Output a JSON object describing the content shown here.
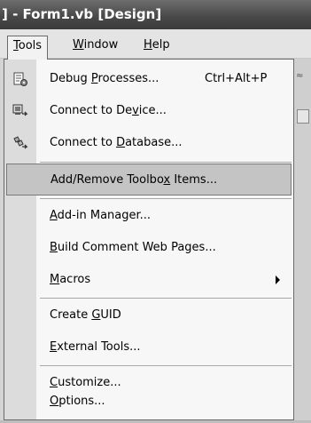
{
  "window": {
    "title": "] - Form1.vb [Design]"
  },
  "menubar": {
    "items": [
      {
        "label": "Tools",
        "mnemonic": "T",
        "rest": "ools",
        "active": true
      },
      {
        "label": "Window",
        "mnemonic": "W",
        "rest": "indow",
        "active": false
      },
      {
        "label": "Help",
        "mnemonic": "H",
        "rest": "elp",
        "active": false
      }
    ]
  },
  "tools_menu": {
    "items": [
      {
        "pre": "Debug ",
        "key": "P",
        "post": "rocesses...",
        "shortcut": "Ctrl+Alt+P",
        "icon": "debug-processes-icon"
      },
      {
        "pre": "Connect to De",
        "key": "v",
        "post": "ice...",
        "icon": "connect-device-icon"
      },
      {
        "pre": "Connect to ",
        "key": "D",
        "post": "atabase...",
        "icon": "connect-database-icon"
      },
      {
        "pre": "Add/Remove Toolbo",
        "key": "x",
        "post": " Items...",
        "highlighted": true
      },
      {
        "pre": "",
        "key": "A",
        "post": "dd-in Manager..."
      },
      {
        "pre": "",
        "key": "B",
        "post": "uild Comment Web Pages..."
      },
      {
        "pre": "",
        "key": "M",
        "post": "acros",
        "submenu": true
      },
      {
        "pre": "Create ",
        "key": "G",
        "post": "UID"
      },
      {
        "pre": "",
        "key": "E",
        "post": "xternal Tools..."
      },
      {
        "pre": "",
        "key": "C",
        "post": "ustomize..."
      },
      {
        "pre": "",
        "key": "O",
        "post": "ptions..."
      }
    ]
  },
  "colors": {
    "title_bg": "#4a4a4a",
    "menu_bg": "#f7f7f7",
    "gutter_bg": "#dcdcdc",
    "highlight_bg": "#c4c4c4"
  }
}
